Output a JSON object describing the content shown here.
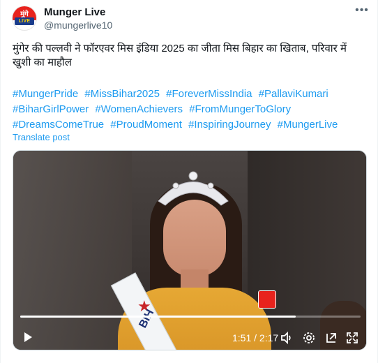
{
  "author": {
    "display_name": "Munger Live",
    "handle": "@mungerlive10",
    "avatar_top_text": "मुंगे",
    "avatar_bottom_text": "LIVE"
  },
  "tweet": {
    "text": "मुंगेर की पल्लवी ने फॉरएवर मिस इंडिया 2025 का जीता मिस बिहार का खिताब, परिवार में खुशी का माहौल",
    "hashtags": [
      "#MungerPride",
      "#MissBihar2025",
      "#ForeverMissIndia",
      "#PallaviKumari",
      "#BiharGirlPower",
      "#WomenAchievers",
      "#FromMungerToGlory",
      "#DreamsComeTrue",
      "#ProudMoment",
      "#InspiringJourney",
      "#MungerLive"
    ],
    "translate_label": "Translate post"
  },
  "video": {
    "sash_text": "BIH",
    "time_display": "1:51 / 2:17",
    "progress": 0.81
  },
  "icons": {
    "more": "more-icon",
    "play": "play-icon",
    "volume": "volume-icon",
    "settings": "settings-icon",
    "pip": "pip-icon",
    "fullscreen": "fullscreen-icon"
  },
  "colors": {
    "link": "#1d9bf0",
    "secondary": "#536471",
    "text": "#0f1419"
  }
}
